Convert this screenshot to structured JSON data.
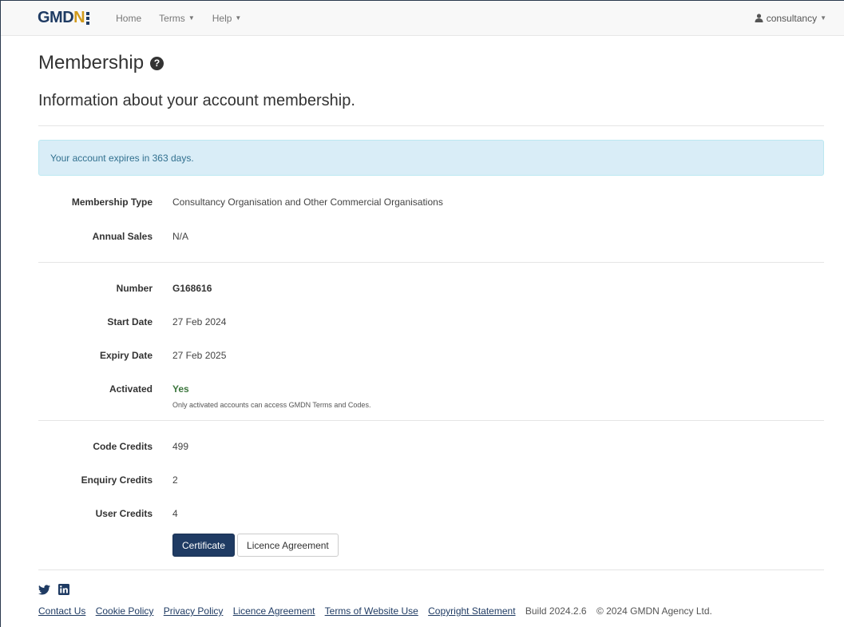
{
  "navbar": {
    "logo_text": "GMD",
    "logo_n": "N",
    "home": "Home",
    "terms": "Terms",
    "help": "Help",
    "user": "consultancy"
  },
  "page": {
    "title": "Membership",
    "subtitle": "Information about your account membership."
  },
  "alert": {
    "text": "Your account expires in 363 days."
  },
  "membership": {
    "type_label": "Membership Type",
    "type_value": "Consultancy Organisation and Other Commercial Organisations",
    "sales_label": "Annual Sales",
    "sales_value": "N/A"
  },
  "account": {
    "number_label": "Number",
    "number_value": "G168616",
    "start_label": "Start Date",
    "start_value": "27 Feb 2024",
    "expiry_label": "Expiry Date",
    "expiry_value": "27 Feb 2025",
    "activated_label": "Activated",
    "activated_value": "Yes",
    "activated_note": "Only activated accounts can access GMDN Terms and Codes."
  },
  "credits": {
    "code_label": "Code Credits",
    "code_value": "499",
    "enquiry_label": "Enquiry Credits",
    "enquiry_value": "2",
    "user_label": "User Credits",
    "user_value": "4"
  },
  "buttons": {
    "certificate": "Certificate",
    "licence": "Licence Agreement"
  },
  "footer": {
    "links": [
      "Contact Us",
      "Cookie Policy",
      "Privacy Policy",
      "Licence Agreement",
      "Terms of Website Use",
      "Copyright Statement"
    ],
    "build": "Build 2024.2.6",
    "copyright": "© 2024 GMDN Agency Ltd."
  },
  "colors": {
    "brand_navy": "#1f3b63",
    "brand_gold": "#d19a1b",
    "alert_bg": "#d9edf7",
    "success_green": "#3c763d"
  }
}
